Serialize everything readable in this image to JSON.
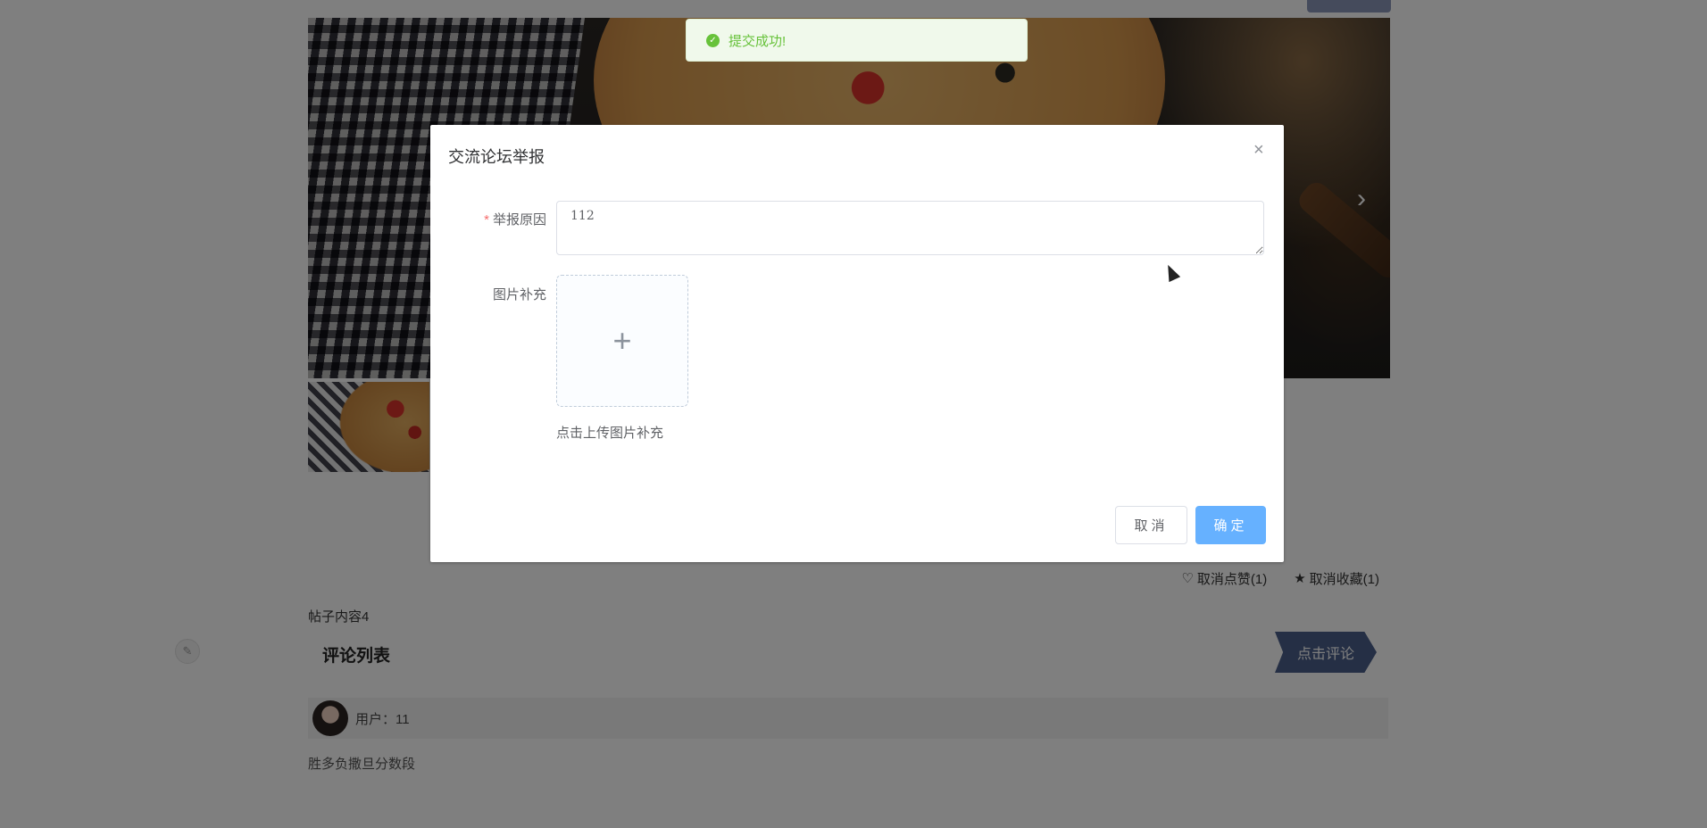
{
  "toast": {
    "icon": "check-circle-icon",
    "text": "提交成功!",
    "color": "#67c23a"
  },
  "dialog": {
    "title": "交流论坛举报",
    "close_icon": "×",
    "reason": {
      "required_mark": "*",
      "label": "举报原因",
      "value": "112"
    },
    "images": {
      "label": "图片补充",
      "plus_icon": "+",
      "tip": "点击上传图片补充"
    },
    "cancel_label": "取消",
    "ok_label": "确定",
    "ok_color": "#66b1ff"
  },
  "carousel": {
    "next_icon": "›"
  },
  "post": {
    "like_icon": "♡",
    "like_label": "取消点赞(1)",
    "fav_icon": "★",
    "fav_label": "取消收藏(1)",
    "content": "帖子内容4"
  },
  "comments": {
    "title": "评论列表",
    "add_label": "点击评论",
    "add_color": "#4b5f8a",
    "items": [
      {
        "user": "用户：11",
        "text": "胜多负撒旦分数段"
      }
    ]
  }
}
